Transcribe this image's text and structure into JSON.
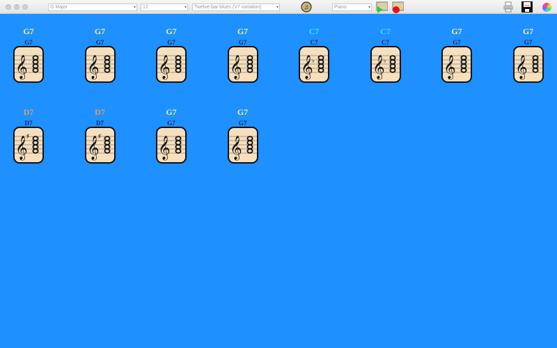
{
  "toolbar": {
    "key_select": "G Major",
    "bars_select": "12",
    "progression_select": "Twelve-bar blues (V7 variation)",
    "instrument_select": "Piano",
    "icons": [
      "add-music-icon",
      "play-sheet-icon",
      "record-sheet-icon",
      "print-icon",
      "save-xml-icon",
      "color-wheel-icon"
    ],
    "xml_label": "XML"
  },
  "colors": {
    "background": "#1e90ff",
    "G7": "#eef27a",
    "C7": "#3fe0ff",
    "D7": "#d6a25a"
  },
  "chords": [
    {
      "name": "G7",
      "sub": "G7",
      "acc": ""
    },
    {
      "name": "G7",
      "sub": "G7",
      "acc": ""
    },
    {
      "name": "G7",
      "sub": "G7",
      "acc": ""
    },
    {
      "name": "G7",
      "sub": "G7",
      "acc": ""
    },
    {
      "name": "C7",
      "sub": "C7",
      "acc": "♭"
    },
    {
      "name": "C7",
      "sub": "C7",
      "acc": "♭"
    },
    {
      "name": "G7",
      "sub": "G7",
      "acc": ""
    },
    {
      "name": "G7",
      "sub": "G7",
      "acc": ""
    },
    {
      "name": "D7",
      "sub": "D7",
      "acc": "♯"
    },
    {
      "name": "D7",
      "sub": "D7",
      "acc": "♯"
    },
    {
      "name": "G7",
      "sub": "G7",
      "acc": ""
    },
    {
      "name": "G7",
      "sub": "G7",
      "acc": ""
    }
  ]
}
